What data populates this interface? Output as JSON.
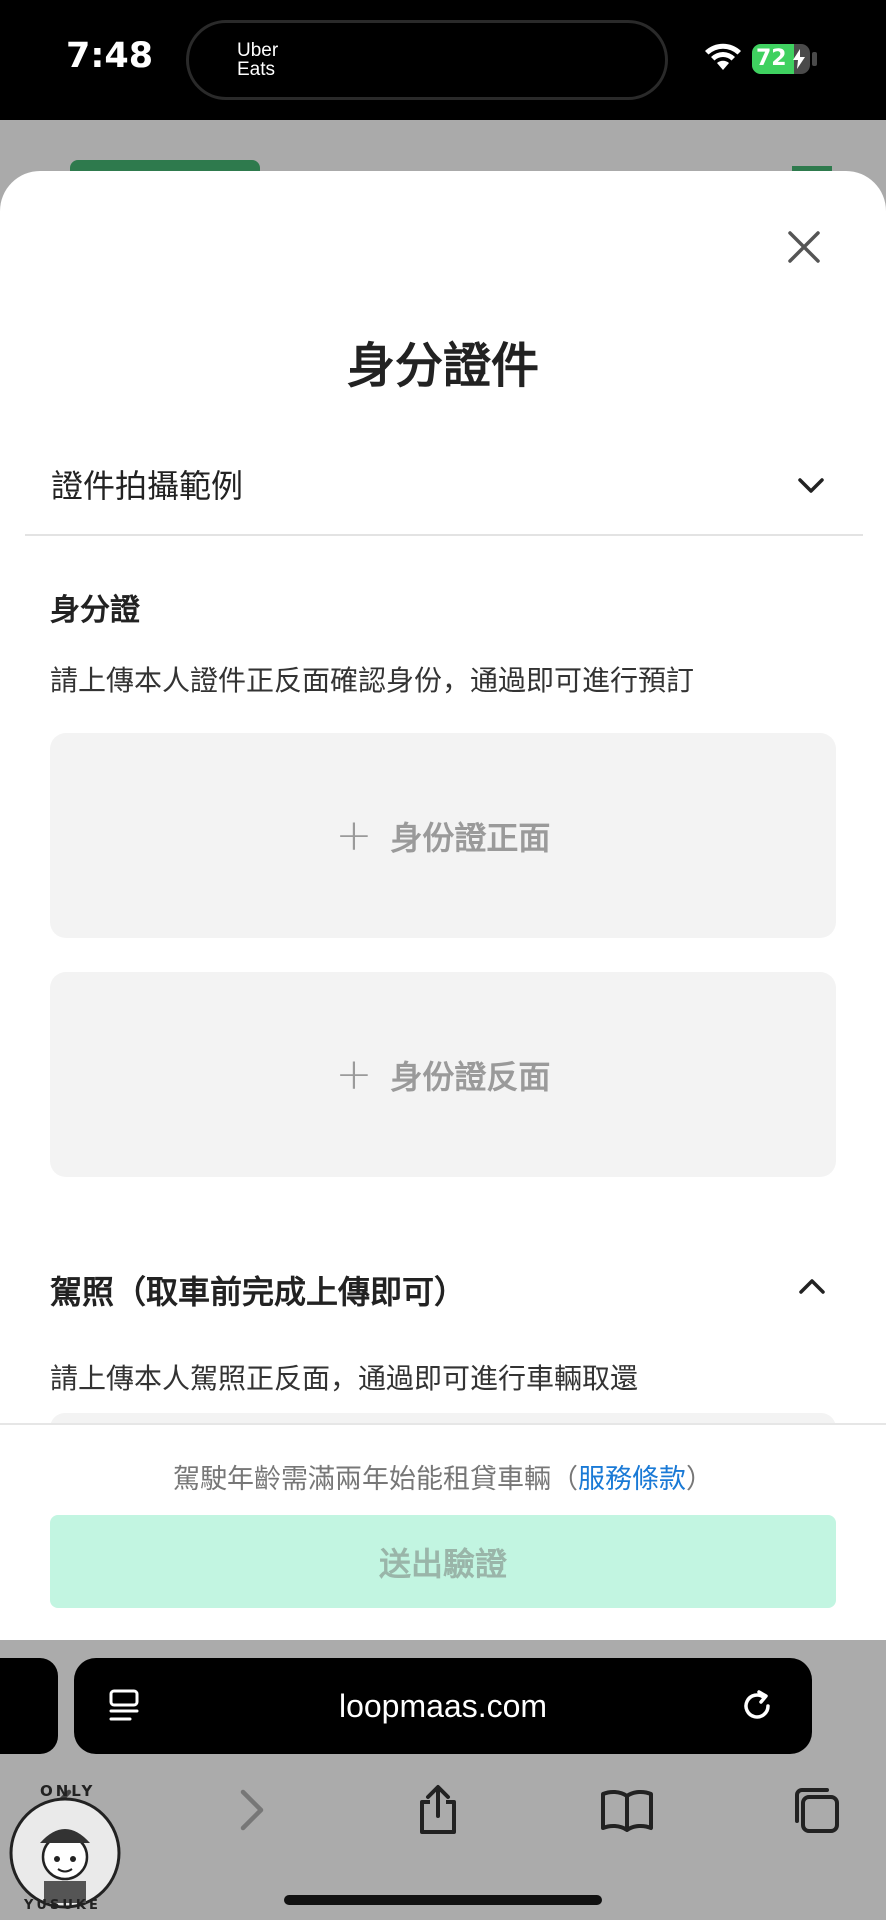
{
  "status_bar": {
    "time": "7:48",
    "island_app": "Uber\nEats",
    "battery": "72",
    "icons": [
      "wifi-icon",
      "battery-icon",
      "charging-bolt-icon"
    ]
  },
  "modal": {
    "title": "身分證件",
    "accordion": {
      "label": "證件拍攝範例",
      "icon": "chevron-down-icon"
    },
    "id_section": {
      "heading": "身分證",
      "description": "請上傳本人證件正反面確認身份，通過即可進行預訂",
      "front_label": "身份證正面",
      "back_label": "身份證反面"
    },
    "license_section": {
      "heading": "駕照（取車前完成上傳即可）",
      "description": "請上傳本人駕照正反面，通過即可進行車輛取還",
      "icon": "chevron-up-icon"
    },
    "footer": {
      "note_prefix": "駕駛年齡需滿兩年始能租貸車輛（",
      "terms_link": "服務條款",
      "note_suffix": "）",
      "submit_label": "送出驗證"
    },
    "colors": {
      "submit_bg": "#c2f5e1",
      "link": "#1a7ad6"
    }
  },
  "browser": {
    "url": "loopmaas.com",
    "toolbar_icons": [
      "back-icon",
      "forward-icon",
      "share-icon",
      "bookmarks-icon",
      "tabs-icon"
    ]
  },
  "watermark": {
    "top_text": "ONLY",
    "bottom_text": "YUSUKE"
  }
}
